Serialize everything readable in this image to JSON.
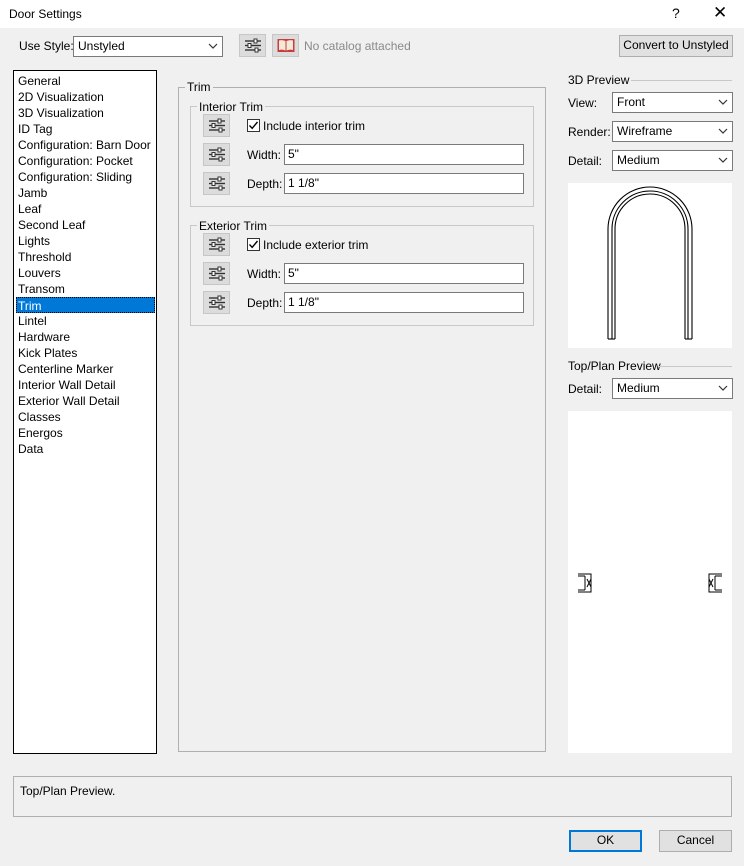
{
  "window": {
    "title": "Door Settings",
    "help_glyph": "?",
    "close_glyph": "✕"
  },
  "toolbar": {
    "use_style_label": "Use Style:",
    "style_value": "Unstyled",
    "catalog_text": "No catalog attached",
    "convert_label": "Convert to Unstyled"
  },
  "sidebar": {
    "items": [
      "General",
      "2D Visualization",
      "3D Visualization",
      "ID Tag",
      "Configuration: Barn Door",
      "Configuration: Pocket",
      "Configuration: Sliding",
      "Jamb",
      "Leaf",
      "Second Leaf",
      "Lights",
      "Threshold",
      "Louvers",
      "Transom",
      "Trim",
      "Lintel",
      "Hardware",
      "Kick Plates",
      "Centerline Marker",
      "Interior Wall Detail",
      "Exterior Wall Detail",
      "Classes",
      "Energos",
      "Data"
    ],
    "selected_index": 14
  },
  "trim": {
    "title": "Trim",
    "interior": {
      "title": "Interior Trim",
      "include_label": "Include interior trim",
      "include_checked": true,
      "width_label": "Width:",
      "width_value": "5\"",
      "depth_label": "Depth:",
      "depth_value": "1 1/8\""
    },
    "exterior": {
      "title": "Exterior Trim",
      "include_label": "Include exterior trim",
      "include_checked": true,
      "width_label": "Width:",
      "width_value": "5\"",
      "depth_label": "Depth:",
      "depth_value": "1 1/8\""
    }
  },
  "preview3d": {
    "title": "3D Preview",
    "view_label": "View:",
    "view_value": "Front",
    "render_label": "Render:",
    "render_value": "Wireframe",
    "detail_label": "Detail:",
    "detail_value": "Medium"
  },
  "plan_preview": {
    "title": "Top/Plan Preview",
    "detail_label": "Detail:",
    "detail_value": "Medium"
  },
  "description": "Top/Plan Preview.",
  "buttons": {
    "ok": "OK",
    "cancel": "Cancel"
  },
  "colors": {
    "selection": "#0078d7",
    "background": "#f0f0f0"
  }
}
